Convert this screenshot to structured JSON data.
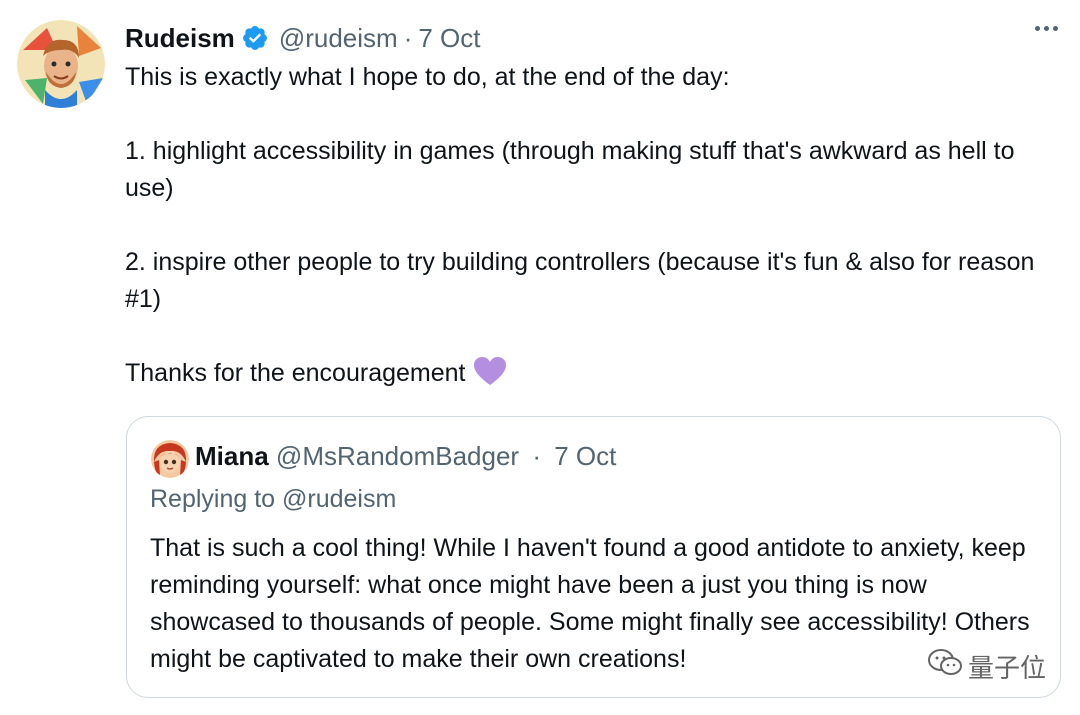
{
  "tweet": {
    "author": {
      "display_name": "Rudeism",
      "handle": "@rudeism",
      "verified": true,
      "avatar_icon": "cartoon-man-avatar"
    },
    "separator": "·",
    "time": "7 Oct",
    "more_icon": "more-horizontal-icon",
    "paragraphs": [
      "This is exactly what I hope to do, at the end of the day:",
      "1. highlight accessibility in games (through making stuff that's awkward as hell to use)",
      "2. inspire other people to try building controllers (because it's fun & also for reason #1)",
      "Thanks for the encouragement"
    ],
    "emoji": "purple-heart",
    "colors": {
      "verified_badge": "#1d9bf0",
      "heart": "#b48ee0",
      "secondary_text": "#536471"
    }
  },
  "quoted": {
    "author": {
      "display_name": "Miana",
      "handle": "@MsRandomBadger"
    },
    "separator": "·",
    "time": "7 Oct",
    "replying_to": "Replying to @rudeism",
    "text": "That is such a cool thing! While I haven't found a good antidote to anxiety, keep reminding yourself: what once might have been a just you thing is now showcased to thousands of people. Some might finally see accessibility! Others might be captivated to make their own creations!"
  },
  "watermark": {
    "icon": "wechat-icon",
    "text": "量子位"
  }
}
